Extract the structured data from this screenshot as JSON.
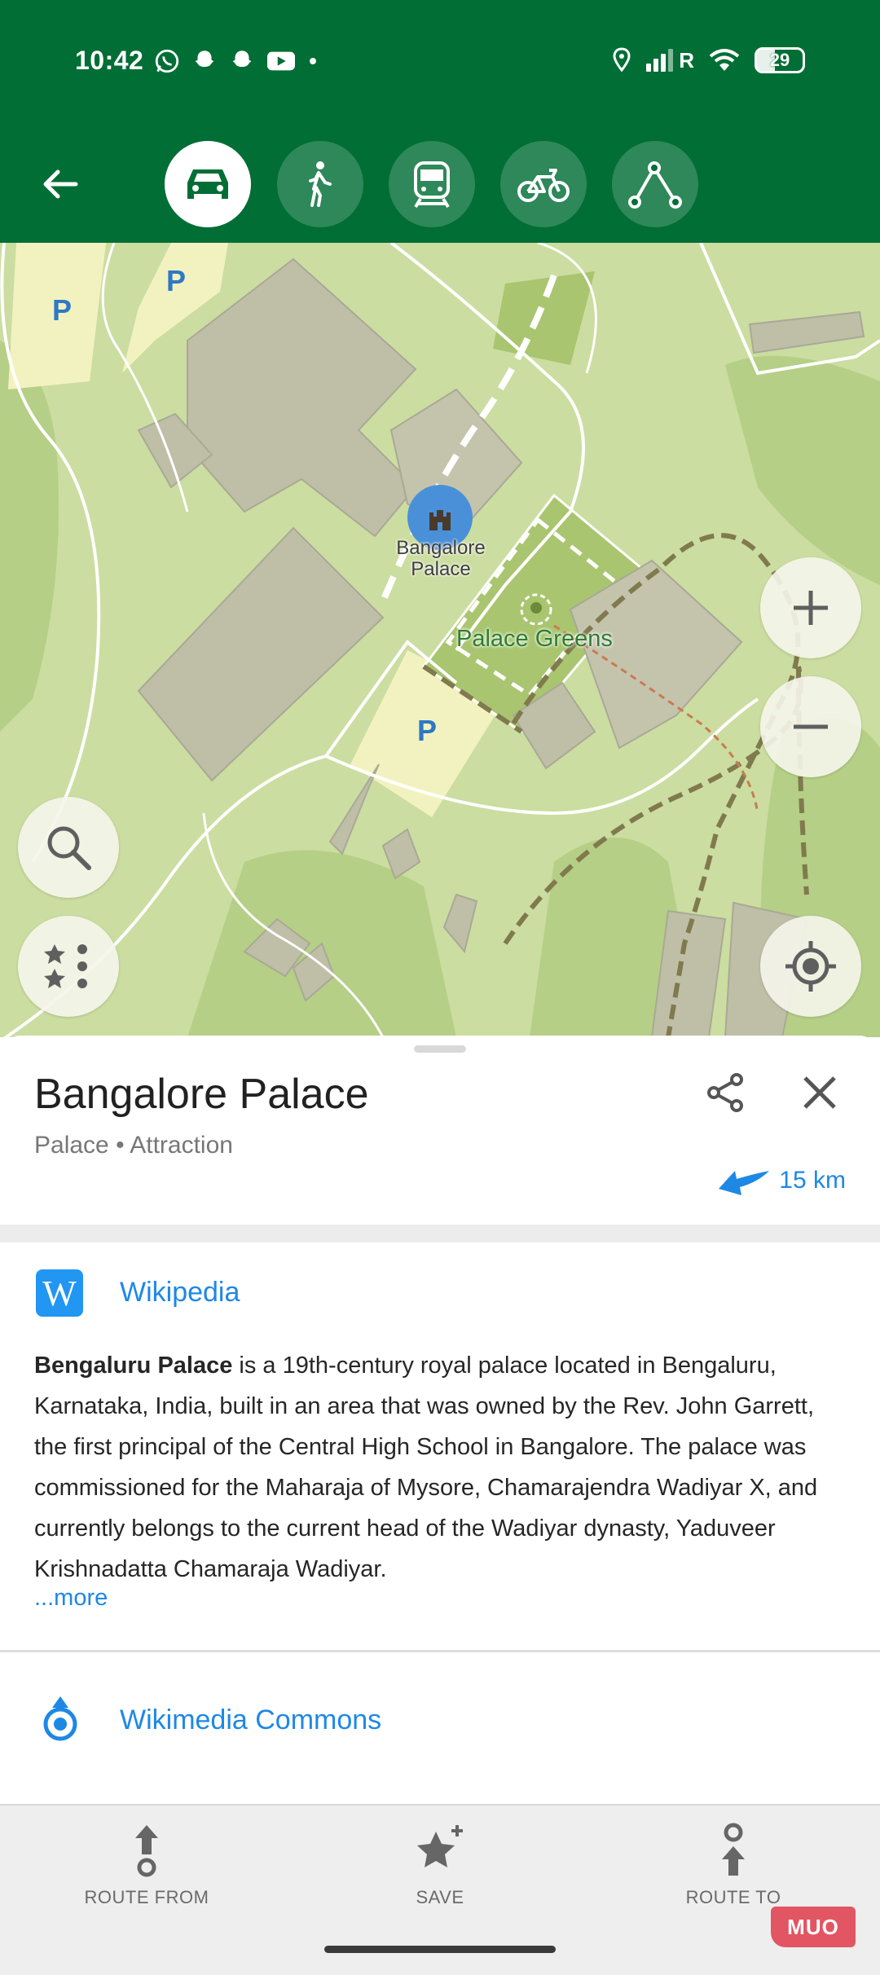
{
  "status_bar": {
    "time": "10:42",
    "network": "R",
    "battery": "29"
  },
  "toolbar": {
    "back_icon": "arrow-left-icon",
    "modes": [
      {
        "name": "car",
        "icon": "car-icon",
        "active": true
      },
      {
        "name": "walk",
        "icon": "walk-icon",
        "active": false
      },
      {
        "name": "transit",
        "icon": "train-icon",
        "active": false
      },
      {
        "name": "bike",
        "icon": "bike-icon",
        "active": false
      },
      {
        "name": "ruler",
        "icon": "route-icon",
        "active": false
      }
    ]
  },
  "map": {
    "poi_label": "Bangalore\nPalace",
    "greens_label": "Palace Greens",
    "parking_symbol": "P",
    "buttons": {
      "zoom_in": "+",
      "zoom_out": "−"
    }
  },
  "place": {
    "title": "Bangalore Palace",
    "subtitle": "Palace • Attraction",
    "distance": "15 km"
  },
  "wikipedia": {
    "logo": "W",
    "link_label": "Wikipedia",
    "text_bold": "Bengaluru Palace",
    "text_rest": " is a 19th-century royal palace located in Bengaluru, Karnataka, India, built in an area that was owned by the Rev. John Garrett, the first principal of the Central High School in Bangalore. The palace was commissioned for the Maharaja of Mysore, Chamarajendra Wadiyar X, and currently belongs to the current head of the Wadiyar dynasty, Yaduveer Krishnadatta Chamaraja Wadiyar.",
    "more_label": "...more"
  },
  "commons": {
    "link_label": "Wikimedia Commons"
  },
  "bottom_bar": {
    "route_from": "ROUTE FROM",
    "save": "SAVE",
    "route_to": "ROUTE TO"
  },
  "watermark": "MUO",
  "colors": {
    "header_green": "#006e35",
    "link_blue": "#1e88e5",
    "map_green": "#c8dc9e"
  }
}
